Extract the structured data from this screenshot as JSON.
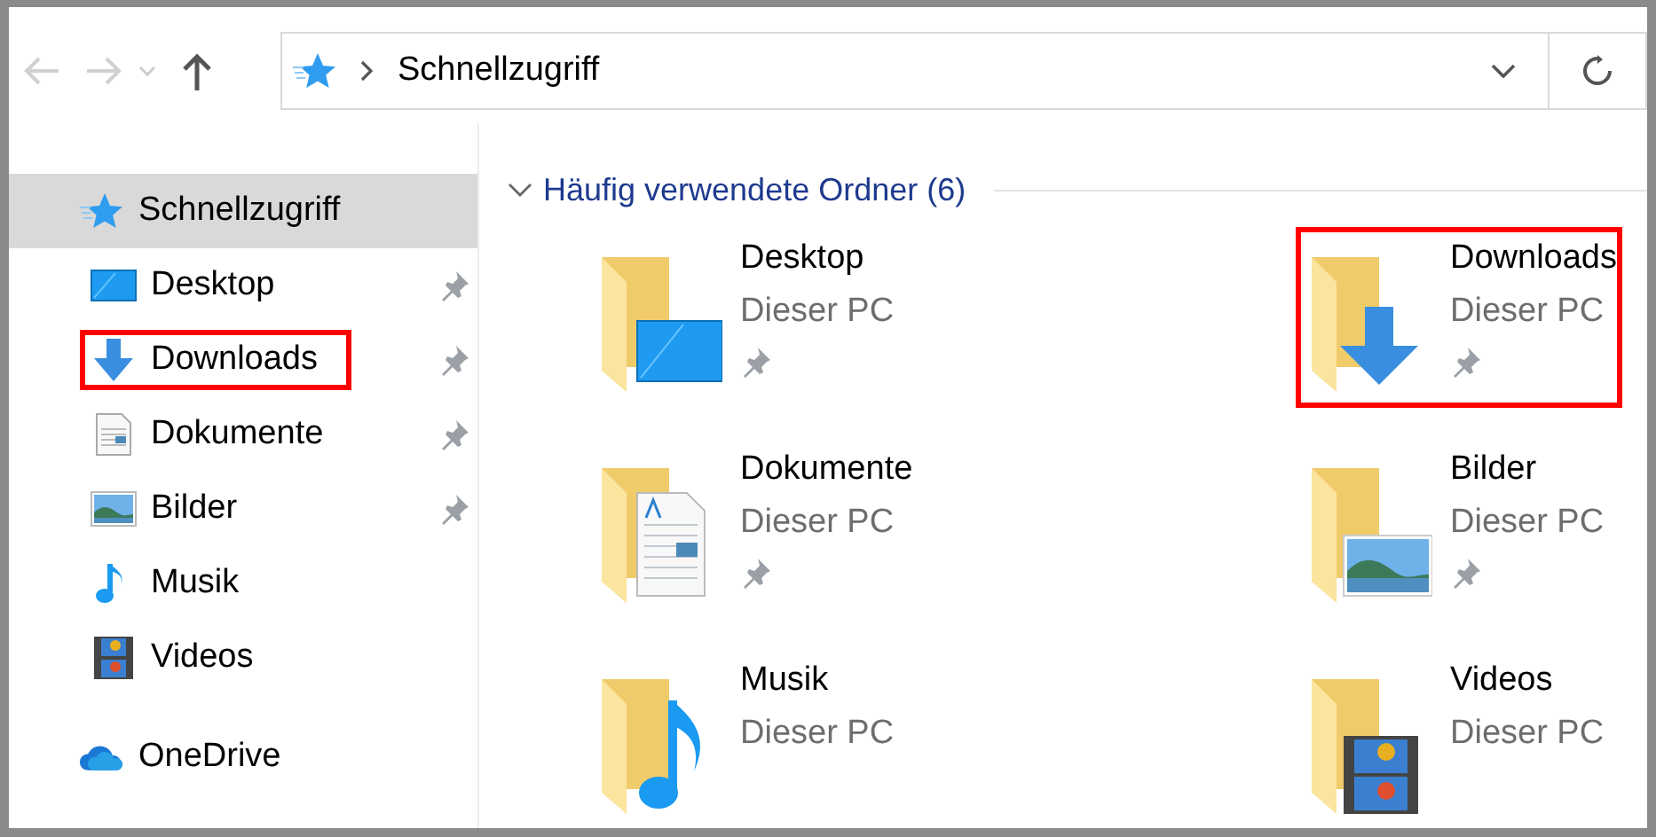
{
  "navigation": {
    "back_disabled": true,
    "forward_disabled": true
  },
  "address_bar": {
    "path": [
      "Schnellzugriff"
    ]
  },
  "sidebar": {
    "items": [
      {
        "label": "Schnellzugriff",
        "selected": true,
        "highlighted": false,
        "children": [
          {
            "label": "Desktop",
            "pinned": true,
            "highlighted": false,
            "selected": false
          },
          {
            "label": "Downloads",
            "pinned": true,
            "highlighted": true,
            "selected": false
          },
          {
            "label": "Dokumente",
            "pinned": true,
            "highlighted": false,
            "selected": false
          },
          {
            "label": "Bilder",
            "pinned": true,
            "highlighted": false,
            "selected": false
          },
          {
            "label": "Musik",
            "pinned": false,
            "highlighted": false,
            "selected": false
          },
          {
            "label": "Videos",
            "pinned": false,
            "highlighted": false,
            "selected": false
          }
        ]
      },
      {
        "label": "OneDrive",
        "selected": false,
        "highlighted": false
      }
    ]
  },
  "content": {
    "section": {
      "title": "Häufig verwendete Ordner (6)",
      "expanded": true,
      "tiles": [
        {
          "name": "Desktop",
          "location": "Dieser PC",
          "pinned": true,
          "highlighted": false
        },
        {
          "name": "Downloads",
          "location": "Dieser PC",
          "pinned": true,
          "highlighted": true
        },
        {
          "name": "Dokumente",
          "location": "Dieser PC",
          "pinned": true,
          "highlighted": false
        },
        {
          "name": "Bilder",
          "location": "Dieser PC",
          "pinned": true,
          "highlighted": false
        },
        {
          "name": "Musik",
          "location": "Dieser PC",
          "pinned": false,
          "highlighted": false
        },
        {
          "name": "Videos",
          "location": "Dieser PC",
          "pinned": false,
          "highlighted": false
        }
      ]
    }
  }
}
